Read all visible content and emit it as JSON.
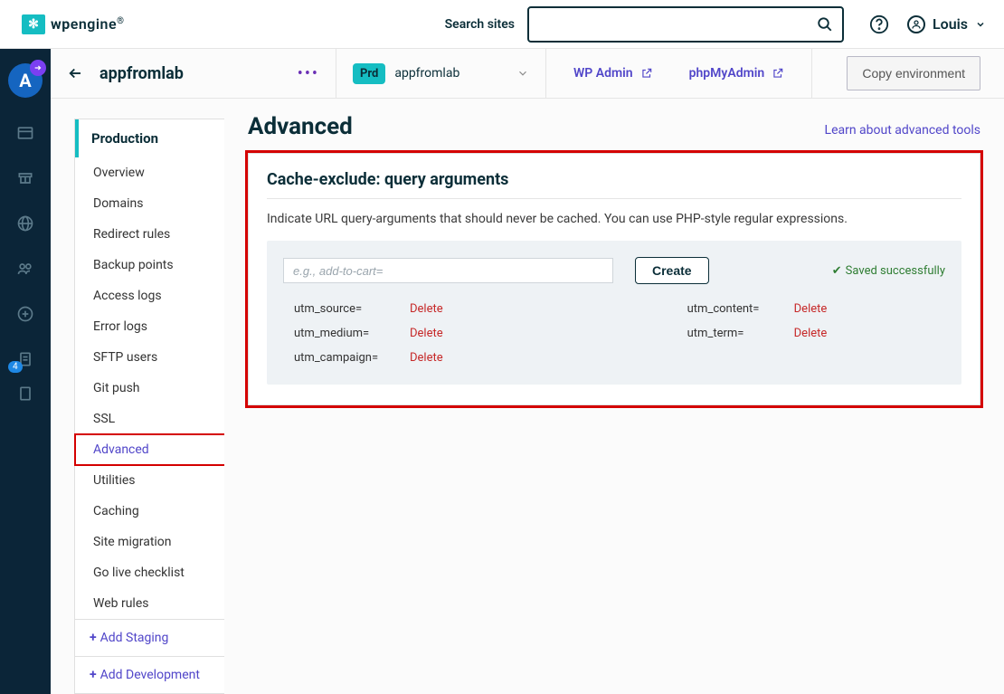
{
  "header": {
    "logo_text_bold": "wp",
    "logo_text_rest": "engine",
    "search_label": "Search sites",
    "search_placeholder": "",
    "user_name": "Louis"
  },
  "icon_rail": {
    "avatar_letter": "A",
    "badge_count": "4"
  },
  "site_bar": {
    "site_name": "appfromlab",
    "env_badge": "Prd",
    "env_name": "appfromlab",
    "wp_admin": "WP Admin",
    "phpmyadmin": "phpMyAdmin",
    "copy_env": "Copy environment"
  },
  "sidebar": {
    "heading": "Production",
    "items": [
      "Overview",
      "Domains",
      "Redirect rules",
      "Backup points",
      "Access logs",
      "Error logs",
      "SFTP users",
      "Git push",
      "SSL",
      "Advanced",
      "Utilities",
      "Caching",
      "Site migration",
      "Go live checklist",
      "Web rules"
    ],
    "add_staging": "Add Staging",
    "add_development": "Add Development"
  },
  "main": {
    "title": "Advanced",
    "learn_link": "Learn about advanced tools",
    "panel_title": "Cache-exclude: query arguments",
    "panel_desc": "Indicate URL query-arguments that should never be cached. You can use PHP-style regular expressions.",
    "input_placeholder": "e.g., add-to-cart=",
    "create_btn": "Create",
    "saved_msg": "Saved successfully",
    "delete_label": "Delete",
    "args_col1": [
      "utm_source=",
      "utm_medium=",
      "utm_campaign="
    ],
    "args_col2": [
      "utm_content=",
      "utm_term="
    ]
  }
}
